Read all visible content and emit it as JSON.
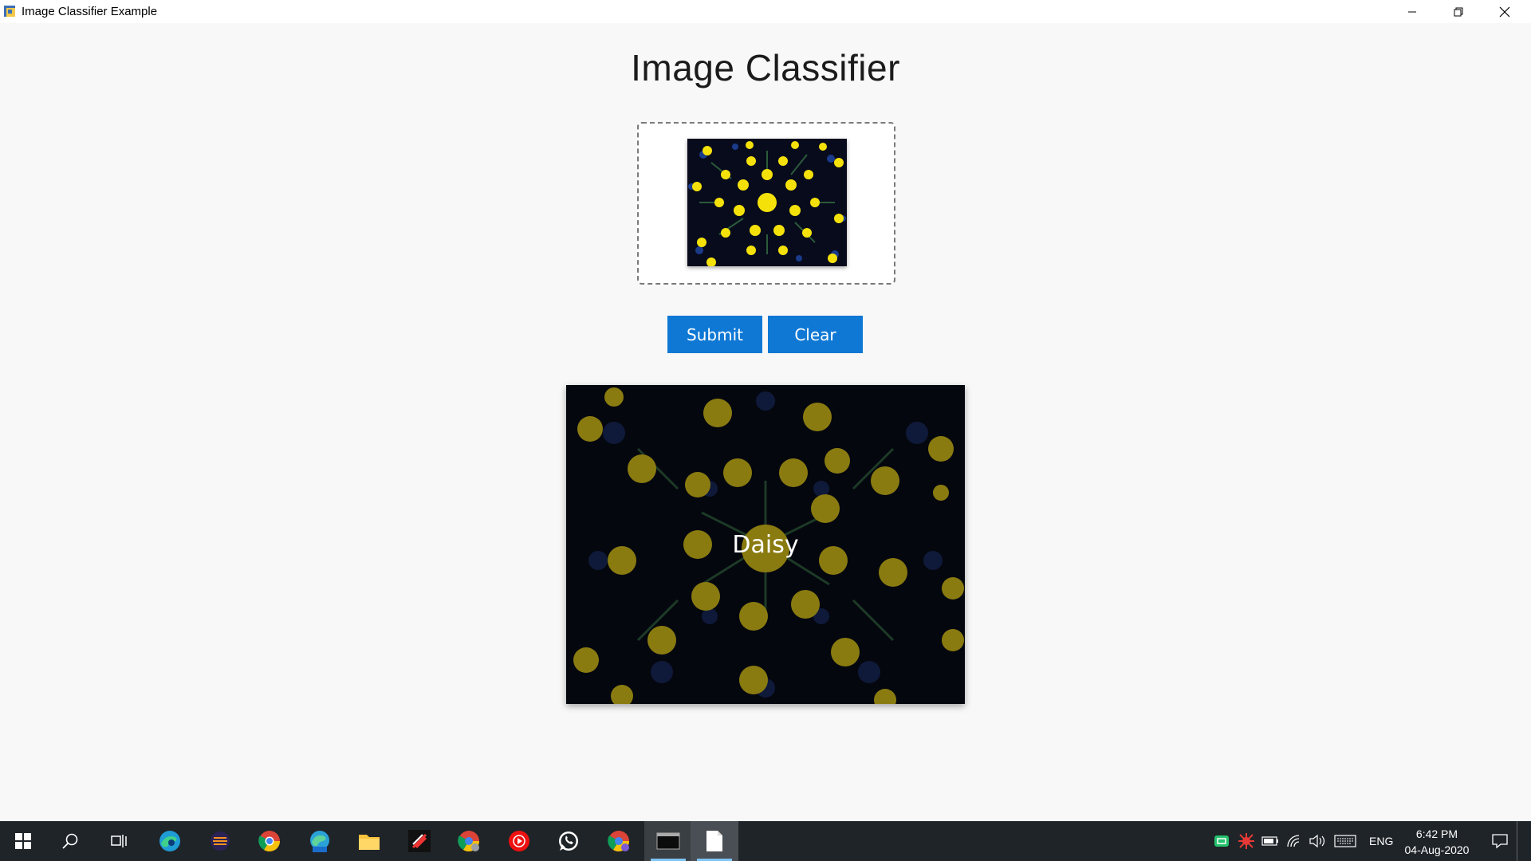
{
  "window": {
    "title": "Image Classifier Example"
  },
  "app": {
    "heading": "Image Classifier",
    "submit_label": "Submit",
    "clear_label": "Clear",
    "prediction": "Daisy"
  },
  "taskbar": {
    "apps": [
      "start-icon",
      "search-icon",
      "task-view-icon",
      "edge-icon",
      "eclipse-icon",
      "chrome-icon",
      "edge-beta-icon",
      "file-explorer-icon",
      "app-icon",
      "chrome-profile-icon",
      "youtube-music-icon",
      "whatsapp-icon",
      "chrome-profile-icon",
      "terminal-icon",
      "notepad-icon"
    ],
    "language": "ENG",
    "time": "6:42 PM",
    "date": "04-Aug-2020"
  },
  "colors": {
    "accent": "#0f78d4",
    "taskbar": "#1f2428",
    "background": "#f8f8f8"
  }
}
